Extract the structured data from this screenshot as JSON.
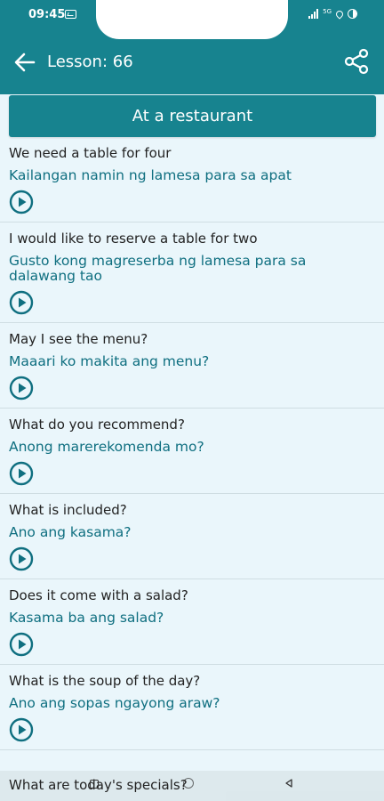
{
  "status": {
    "time": "09:45",
    "network": "5G"
  },
  "header": {
    "title": "Lesson: 66"
  },
  "banner": {
    "title": "At a restaurant"
  },
  "phrases": [
    {
      "en": "We need a table for four",
      "tl": "Kailangan namin ng lamesa para sa apat"
    },
    {
      "en": "I would like to reserve a table for two",
      "tl": "Gusto kong magreserba ng lamesa para sa dalawang tao"
    },
    {
      "en": "May I see the menu?",
      "tl": "Maaari ko makita ang menu?"
    },
    {
      "en": "What do you recommend?",
      "tl": "Anong marerekomenda mo?"
    },
    {
      "en": "What is included?",
      "tl": "Ano ang kasama?"
    },
    {
      "en": "Does it come with a salad?",
      "tl": "Kasama ba ang salad?"
    },
    {
      "en": "What is the soup of the day?",
      "tl": "Ano ang sopas ngayong araw?"
    }
  ],
  "partial_item": {
    "en": "What are today's specials?"
  },
  "colors": {
    "primary": "#17838f",
    "background": "#eaf6fb",
    "translation": "#0f6f80"
  }
}
